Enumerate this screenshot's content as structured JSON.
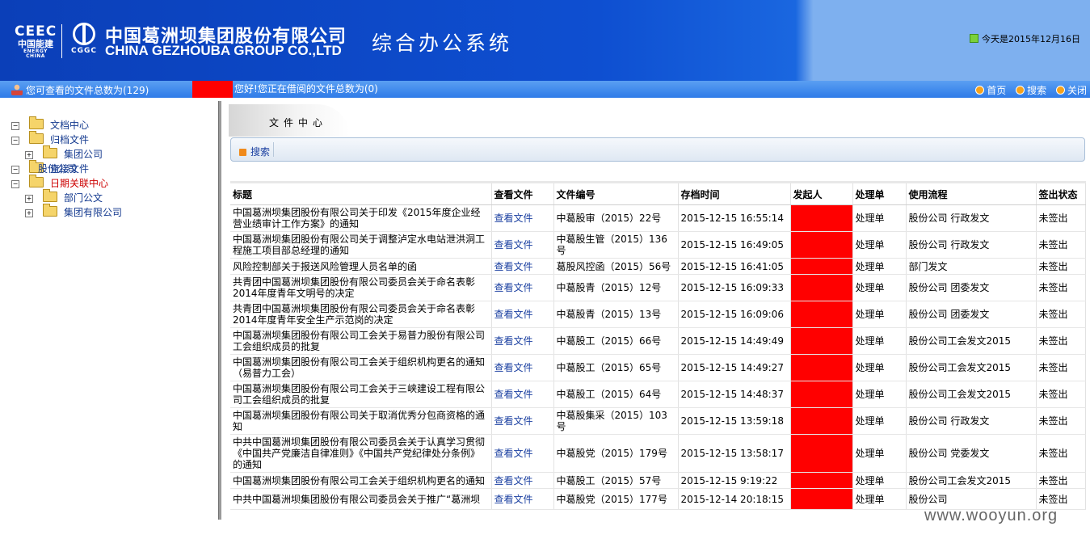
{
  "header": {
    "logo_ce_big": "CEEC",
    "logo_ce_cn": "中国能建",
    "logo_ce_en": "ENERGY CHINA",
    "logo_cg_abbr": "CGGC",
    "company_cn": "中国葛洲坝集团股份有限公司",
    "company_en": "CHINA GEZHOUBA GROUP CO.,LTD",
    "system_title": "综合办公系统",
    "date_text": "今天是2015年12月16日"
  },
  "navbar": {
    "left_text": "您可查看的文件总数为(129)",
    "hello": "您好!",
    "borrow_text": "您正在借阅的文件总数为(0)",
    "links": [
      "首页",
      "搜索",
      "关闭"
    ]
  },
  "tree": {
    "doc_center": "文档中心",
    "archive": "归档文件",
    "group_company": "集团公司",
    "overlap_1": "直接文件",
    "overlap_2": "股份公司",
    "overlap_3": "日期关联中心",
    "overlap_4": "日版文件",
    "dept": "部门公文",
    "group_ltd": "集团有限公司"
  },
  "main": {
    "section_title": "文件中心",
    "search_label": "搜索",
    "columns": [
      "标题",
      "查看文件",
      "文件编号",
      "存档时间",
      "发起人",
      "处理单",
      "使用流程",
      "签出状态"
    ],
    "rows": [
      {
        "title": "中国葛洲坝集团股份有限公司关于印发《2015年度企业经营业绩审计工作方案》的通知",
        "view": "查看文件",
        "code": "中葛股审（2015）22号",
        "time": "2015-12-15 16:55:14",
        "proc": "处理单",
        "flow": "股份公司 行政发文",
        "status": "未签出"
      },
      {
        "title": "中国葛洲坝集团股份有限公司关于调整泸定水电站泄洪洞工程施工项目部总经理的通知",
        "view": "查看文件",
        "code": "中葛股生管（2015）136号",
        "time": "2015-12-15 16:49:05",
        "proc": "处理单",
        "flow": "股份公司 行政发文",
        "status": "未签出"
      },
      {
        "title": "风险控制部关于报送风险管理人员名单的函",
        "view": "查看文件",
        "code": "葛股风控函（2015）56号",
        "time": "2015-12-15 16:41:05",
        "proc": "处理单",
        "flow": "部门发文",
        "status": "未签出"
      },
      {
        "title": "共青团中国葛洲坝集团股份有限公司委员会关于命名表彰2014年度青年文明号的决定",
        "view": "查看文件",
        "code": "中葛股青（2015）12号",
        "time": "2015-12-15 16:09:33",
        "proc": "处理单",
        "flow": "股份公司 团委发文",
        "status": "未签出"
      },
      {
        "title": "共青团中国葛洲坝集团股份有限公司委员会关于命名表彰2014年度青年安全生产示范岗的决定",
        "view": "查看文件",
        "code": "中葛股青（2015）13号",
        "time": "2015-12-15 16:09:06",
        "proc": "处理单",
        "flow": "股份公司 团委发文",
        "status": "未签出"
      },
      {
        "title": "中国葛洲坝集团股份有限公司工会关于易普力股份有限公司工会组织成员的批复",
        "view": "查看文件",
        "code": "中葛股工（2015）66号",
        "time": "2015-12-15 14:49:49",
        "proc": "处理单",
        "flow": "股份公司工会发文2015",
        "status": "未签出"
      },
      {
        "title": "中国葛洲坝集团股份有限公司工会关于组织机构更名的通知（易普力工会）",
        "view": "查看文件",
        "code": "中葛股工（2015）65号",
        "time": "2015-12-15 14:49:27",
        "proc": "处理单",
        "flow": "股份公司工会发文2015",
        "status": "未签出"
      },
      {
        "title": "中国葛洲坝集团股份有限公司工会关于三峡建设工程有限公司工会组织成员的批复",
        "view": "查看文件",
        "code": "中葛股工（2015）64号",
        "time": "2015-12-15 14:48:37",
        "proc": "处理单",
        "flow": "股份公司工会发文2015",
        "status": "未签出"
      },
      {
        "title": "中国葛洲坝集团股份有限公司关于取消优秀分包商资格的通知",
        "view": "查看文件",
        "code": "中葛股集采（2015）103号",
        "time": "2015-12-15 13:59:18",
        "proc": "处理单",
        "flow": "股份公司 行政发文",
        "status": "未签出"
      },
      {
        "title": "中共中国葛洲坝集团股份有限公司委员会关于认真学习贯彻《中国共产党廉洁自律准则》《中国共产党纪律处分条例》的通知",
        "view": "查看文件",
        "code": "中葛股党（2015）179号",
        "time": "2015-12-15 13:58:17",
        "proc": "处理单",
        "flow": "股份公司 党委发文",
        "status": "未签出"
      },
      {
        "title": "中国葛洲坝集团股份有限公司工会关于组织机构更名的通知",
        "view": "查看文件",
        "code": "中葛股工（2015）57号",
        "time": "2015-12-15 9:19:22",
        "proc": "处理单",
        "flow": "股份公司工会发文2015",
        "status": "未签出"
      },
      {
        "title": "中共中国葛洲坝集团股份有限公司委员会关于推广“葛洲坝",
        "view": "查看文件",
        "code": "中葛股党（2015）177号",
        "time": "2015-12-14 20:18:15",
        "proc": "处理单",
        "flow": "股份公司",
        "status": "未签出"
      }
    ]
  },
  "watermark": "www.wooyun.org",
  "colors": {
    "header_blue": "#0e4fd1",
    "redaction": "#ff0000",
    "link": "#1a3fa0"
  }
}
